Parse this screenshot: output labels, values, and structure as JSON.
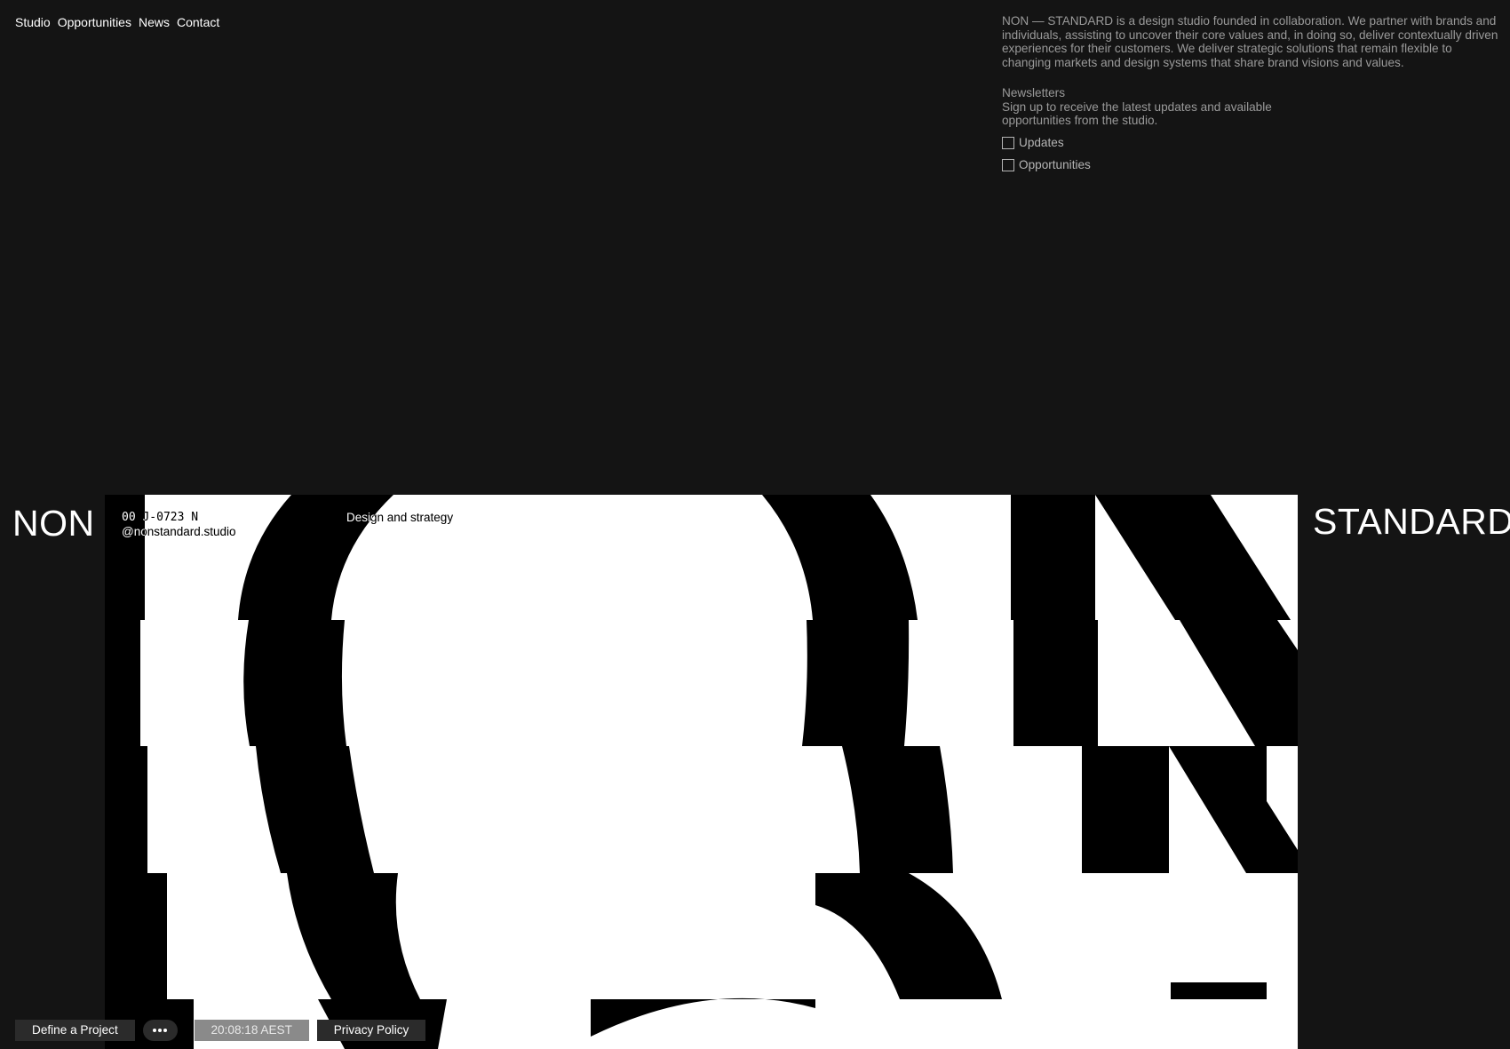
{
  "nav": {
    "items": [
      "Studio",
      "Opportunities",
      "News",
      "Contact"
    ]
  },
  "about": {
    "text": "NON — STANDARD is a design studio founded in collaboration. We partner with brands and individuals, assisting to uncover their core values and, in doing so, deliver contextually driven experiences for their customers. We deliver strategic solutions that remain flexible to changing markets and design systems that share brand visions and values."
  },
  "newsletter": {
    "title": "Newsletters",
    "description": "Sign up to receive the latest updates and available opportunities from the studio.",
    "options": [
      {
        "label": "Updates",
        "checked": false
      },
      {
        "label": "Opportunities",
        "checked": false
      }
    ]
  },
  "brand": {
    "left": "NON",
    "right": "STANDARD"
  },
  "hero": {
    "code": "00 J-0723 N",
    "handle": "@nonstandard.studio",
    "tagline": "Design and strategy"
  },
  "footer": {
    "define_project": "Define a Project",
    "more_icon": "more-dots-icon",
    "clock": "20:08:18 AEST",
    "privacy": "Privacy Policy"
  },
  "colors": {
    "background": "#141414",
    "hero_bg": "#ffffff",
    "muted_text": "#9a9a9a",
    "button_bg": "#2b2b2b",
    "clock_bg": "#8a8a8a"
  }
}
